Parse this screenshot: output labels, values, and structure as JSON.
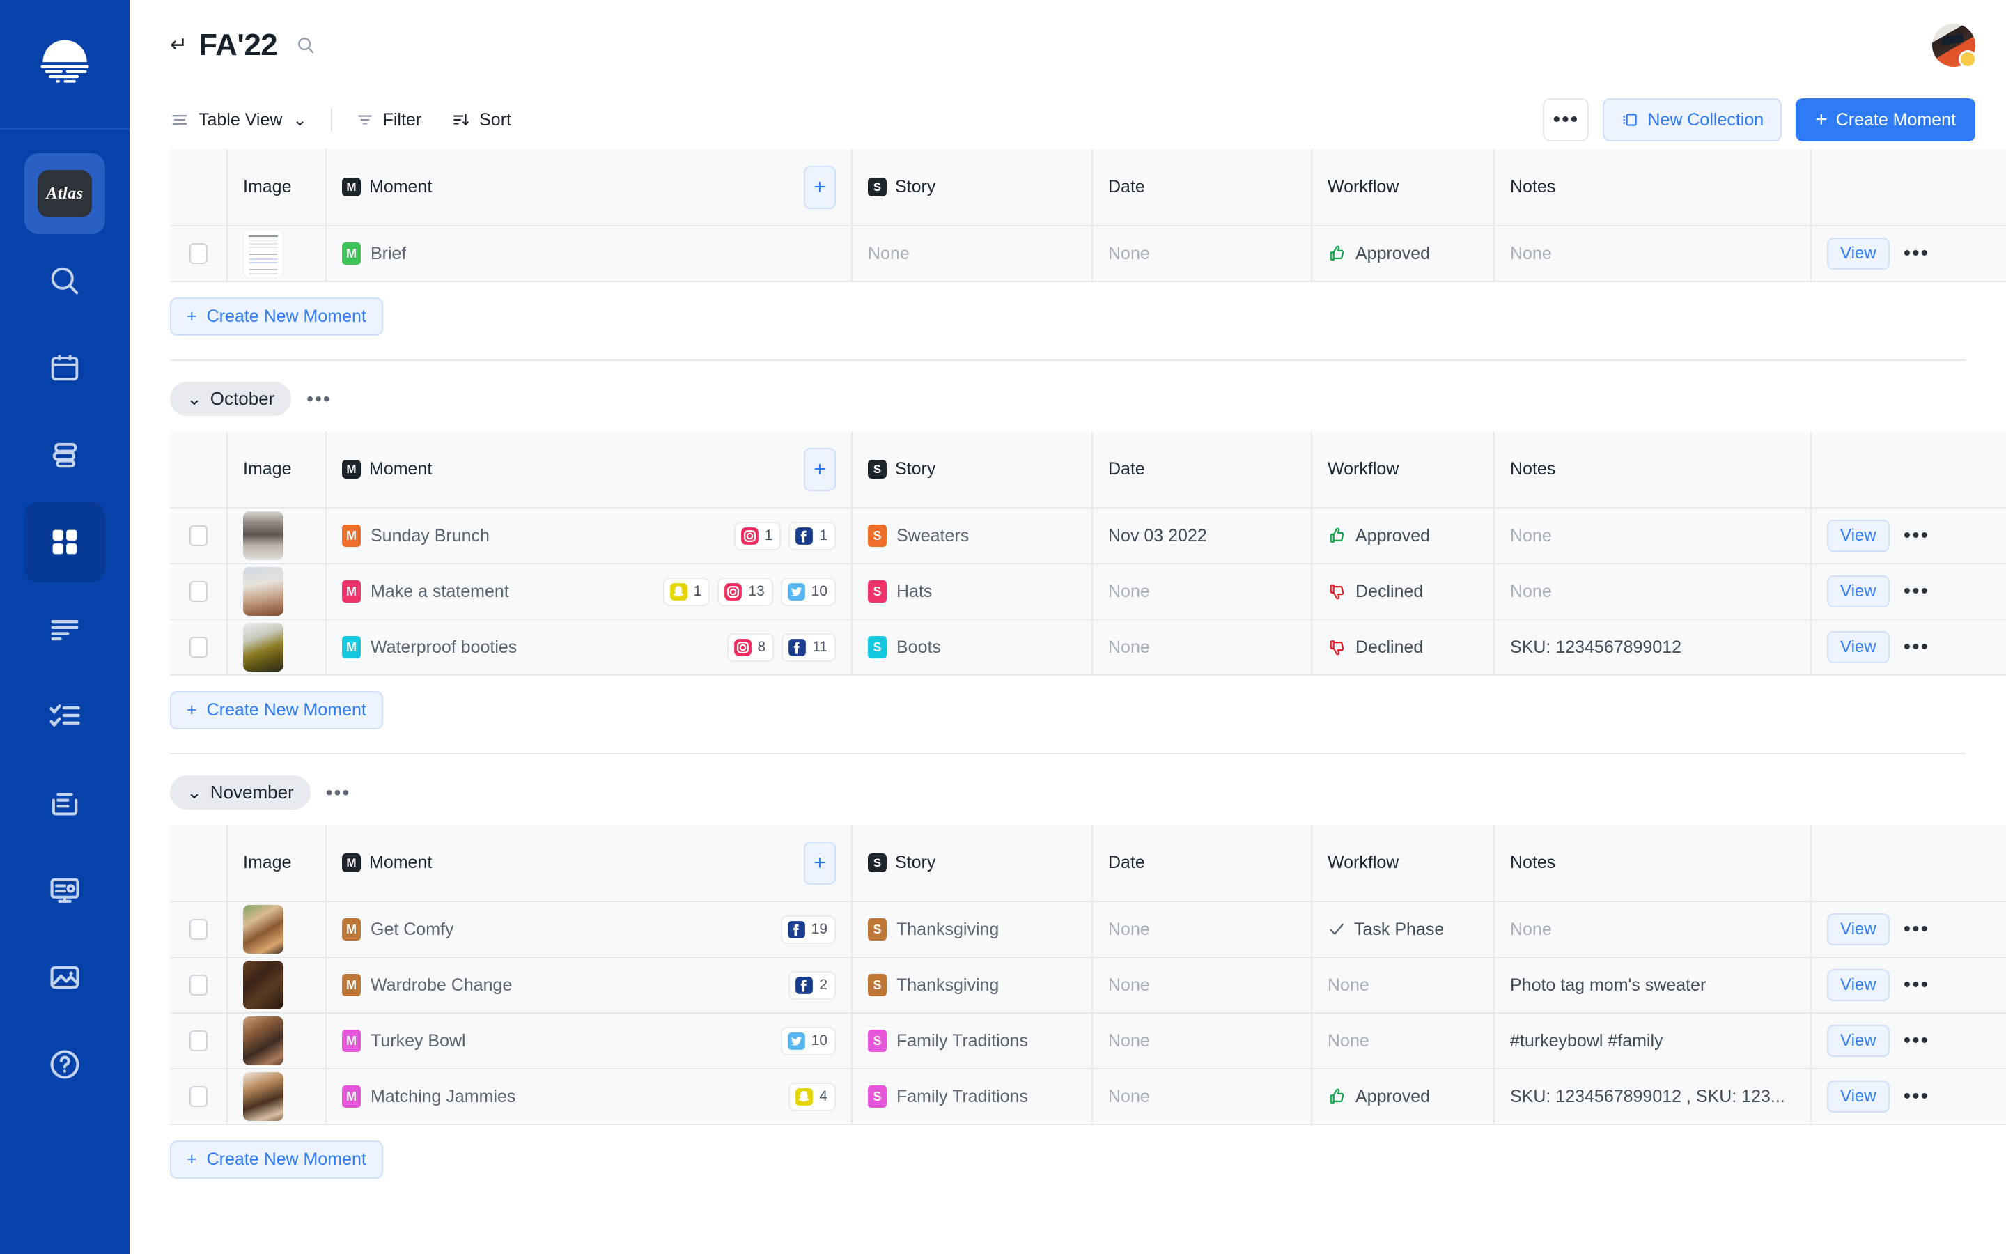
{
  "sidebar": {
    "logo_icon": "sunrise-logo-icon",
    "brand_label": "Atlas",
    "items": [
      {
        "name": "brand-atlas",
        "icon": "atlas-brand-icon",
        "label": "Atlas"
      },
      {
        "name": "search",
        "icon": "search-icon",
        "label": "Search"
      },
      {
        "name": "calendar",
        "icon": "calendar-icon",
        "label": "Calendar"
      },
      {
        "name": "stack",
        "icon": "stack-icon",
        "label": "Stack"
      },
      {
        "name": "grid",
        "icon": "grid-icon",
        "label": "Collections"
      },
      {
        "name": "text-lines",
        "icon": "text-lines-icon",
        "label": "Briefs"
      },
      {
        "name": "checklist",
        "icon": "checklist-icon",
        "label": "Tasks"
      },
      {
        "name": "inbox",
        "icon": "inbox-icon",
        "label": "Inbox"
      },
      {
        "name": "presentation",
        "icon": "presentation-icon",
        "label": "Presentations"
      },
      {
        "name": "image",
        "icon": "image-icon",
        "label": "Assets"
      },
      {
        "name": "help",
        "icon": "help-circle-icon",
        "label": "Help"
      }
    ]
  },
  "header": {
    "back_icon": "back-arrow-icon",
    "back_glyph": "↵",
    "title": "FA'22",
    "search_icon": "search-icon",
    "avatar_name": "user-avatar",
    "avatar_status": "away"
  },
  "toolbar": {
    "view_label": "Table View",
    "view_caret": "⌄",
    "filter_label": "Filter",
    "sort_label": "Sort",
    "more_label": "•••",
    "new_collection_label": "New Collection",
    "create_moment_label": "Create Moment",
    "create_moment_plus": "+",
    "new_collection_plus": "+"
  },
  "columns": {
    "image": "Image",
    "moment": "Moment",
    "story": "Story",
    "date": "Date",
    "workflow": "Workflow",
    "notes": "Notes",
    "moment_tag": "M",
    "story_tag": "S",
    "add_column": "+"
  },
  "labels": {
    "create_new_moment": "Create New Moment",
    "view": "View",
    "row_more": "•••",
    "group_more": "•••",
    "none": "None",
    "plus": "+",
    "chevron": "⌄"
  },
  "colors": {
    "sidebar": "#0742AB",
    "accent": "#2F7BF6",
    "accent_soft": "#EDF3FF",
    "table_bg": "#F7F9FB",
    "border": "#E6EAEF",
    "approved": "#16A34A",
    "declined": "#E0222A",
    "task_phase": "#5B6573"
  },
  "sections": [
    {
      "id": "ungrouped",
      "has_group_header": false,
      "group_label": "",
      "rows": [
        {
          "thumb_class": "doc",
          "thumb_kind": "document-thumbnail",
          "moment_color": "#3DC257",
          "moment": "Brief",
          "socials": [],
          "story": "None",
          "story_muted": true,
          "story_color": "",
          "date": "None",
          "date_muted": true,
          "workflow": "Approved",
          "workflow_state": "approved",
          "notes": "None",
          "notes_muted": true
        }
      ]
    },
    {
      "id": "october",
      "has_group_header": true,
      "group_label": "October",
      "rows": [
        {
          "thumb_class": "ph1",
          "thumb_kind": "photo-thumbnail",
          "moment_color": "#EE6D28",
          "moment": "Sunday Brunch",
          "socials": [
            {
              "network": "instagram",
              "count": "1"
            },
            {
              "network": "facebook",
              "count": "1"
            }
          ],
          "story": "Sweaters",
          "story_muted": false,
          "story_color": "#EE6D28",
          "date": "Nov 03 2022",
          "date_muted": false,
          "workflow": "Approved",
          "workflow_state": "approved",
          "notes": "None",
          "notes_muted": true
        },
        {
          "thumb_class": "ph2",
          "thumb_kind": "photo-thumbnail",
          "moment_color": "#F0326B",
          "moment": "Make a statement",
          "socials": [
            {
              "network": "snapchat",
              "count": "1"
            },
            {
              "network": "instagram",
              "count": "13"
            },
            {
              "network": "twitter",
              "count": "10"
            }
          ],
          "story": "Hats",
          "story_muted": false,
          "story_color": "#F0326B",
          "date": "None",
          "date_muted": true,
          "workflow": "Declined",
          "workflow_state": "declined",
          "notes": "None",
          "notes_muted": true
        },
        {
          "thumb_class": "ph3",
          "thumb_kind": "photo-thumbnail",
          "moment_color": "#14C8E0",
          "moment": "Waterproof booties",
          "socials": [
            {
              "network": "instagram",
              "count": "8"
            },
            {
              "network": "facebook",
              "count": "11"
            }
          ],
          "story": "Boots",
          "story_muted": false,
          "story_color": "#14C8E0",
          "date": "None",
          "date_muted": true,
          "workflow": "Declined",
          "workflow_state": "declined",
          "notes": "SKU: 1234567899012",
          "notes_muted": false
        }
      ]
    },
    {
      "id": "november",
      "has_group_header": true,
      "group_label": "November",
      "rows": [
        {
          "thumb_class": "ph4",
          "thumb_kind": "photo-thumbnail",
          "moment_color": "#BE7636",
          "moment": "Get Comfy",
          "socials": [
            {
              "network": "facebook",
              "count": "19"
            }
          ],
          "story": "Thanksgiving",
          "story_muted": false,
          "story_color": "#BE7636",
          "date": "None",
          "date_muted": true,
          "workflow": "Task Phase",
          "workflow_state": "task",
          "notes": "None",
          "notes_muted": true
        },
        {
          "thumb_class": "ph5",
          "thumb_kind": "photo-thumbnail",
          "moment_color": "#BE7636",
          "moment": "Wardrobe Change",
          "socials": [
            {
              "network": "facebook",
              "count": "2"
            }
          ],
          "story": "Thanksgiving",
          "story_muted": false,
          "story_color": "#BE7636",
          "date": "None",
          "date_muted": true,
          "workflow": "None",
          "workflow_state": "none",
          "notes": "Photo tag mom's sweater",
          "notes_muted": false
        },
        {
          "thumb_class": "ph6",
          "thumb_kind": "photo-thumbnail",
          "moment_color": "#E557D8",
          "moment": "Turkey Bowl",
          "socials": [
            {
              "network": "twitter",
              "count": "10"
            }
          ],
          "story": "Family Traditions",
          "story_muted": false,
          "story_color": "#E557D8",
          "date": "None",
          "date_muted": true,
          "workflow": "None",
          "workflow_state": "none",
          "notes": "#turkeybowl #family",
          "notes_muted": false
        },
        {
          "thumb_class": "ph7",
          "thumb_kind": "photo-thumbnail",
          "moment_color": "#E557D8",
          "moment": "Matching Jammies",
          "socials": [
            {
              "network": "snapchat",
              "count": "4"
            }
          ],
          "story": "Family Traditions",
          "story_muted": false,
          "story_color": "#E557D8",
          "date": "None",
          "date_muted": true,
          "workflow": "Approved",
          "workflow_state": "approved",
          "notes": "SKU: 1234567899012 , SKU: 123...",
          "notes_muted": false
        }
      ]
    }
  ]
}
